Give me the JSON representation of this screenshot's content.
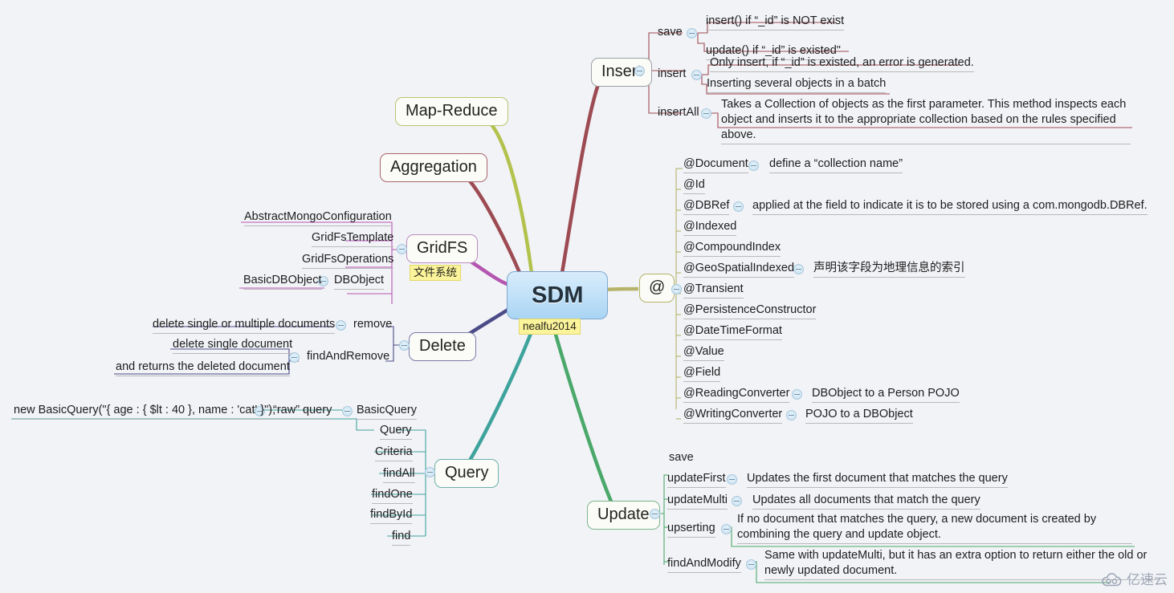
{
  "central": {
    "title": "SDM",
    "tag": "nealfu2014"
  },
  "watermark": {
    "text": "亿速云",
    "icon": "cloud-icon"
  },
  "branches": {
    "insert": {
      "label": "Insert",
      "color": "#9d4b52",
      "items": [
        {
          "label": "save",
          "notes": [
            "insert() if “_id” is NOT exist",
            "update() if “_id” is existed\""
          ]
        },
        {
          "label": "insert",
          "notes": [
            "Only insert, if “_id” is existed, an error is generated.",
            "Inserting several objects in a batch"
          ]
        },
        {
          "label": "insertAll",
          "notes": [
            "Takes a Collection of objects as the first parameter. This method inspects each object and inserts it to the appropriate collection based on the rules specified above."
          ]
        }
      ]
    },
    "mapreduce": {
      "label": "Map-Reduce",
      "color": "#b3c24d"
    },
    "aggregation": {
      "label": "Aggregation",
      "color": "#9d4b52"
    },
    "gridfs": {
      "label": "GridFS",
      "tag": "文件系统",
      "color": "#b455b0",
      "items": [
        {
          "label": "AbstractMongoConfiguration"
        },
        {
          "label": "GridFsTemplate"
        },
        {
          "label": "GridFsOperations"
        },
        {
          "label": "DBObject",
          "note": "BasicDBObject"
        }
      ]
    },
    "annotations": {
      "label": "@",
      "color": "#b5b46a",
      "items": [
        {
          "label": "@Document",
          "note": "define a “collection name”"
        },
        {
          "label": "@Id",
          "note": ""
        },
        {
          "label": "@DBRef",
          "note": "applied at the field to indicate it is to be stored using a com.mongodb.DBRef."
        },
        {
          "label": "@Indexed",
          "note": ""
        },
        {
          "label": "@CompoundIndex",
          "note": ""
        },
        {
          "label": "@GeoSpatialIndexed",
          "note": "声明该字段为地理信息的索引"
        },
        {
          "label": "@Transient",
          "note": ""
        },
        {
          "label": "@PersistenceConstructor",
          "note": ""
        },
        {
          "label": "@DateTimeFormat",
          "note": ""
        },
        {
          "label": "@Value",
          "note": ""
        },
        {
          "label": "@Field",
          "note": ""
        },
        {
          "label": "@ReadingConverter",
          "note": "DBObject to a Person POJO"
        },
        {
          "label": "@WritingConverter",
          "note": "POJO to a DBObject"
        }
      ]
    },
    "delete": {
      "label": "Delete",
      "color": "#4b4b88",
      "items": [
        {
          "label": "remove",
          "notes": [
            "delete single or multiple documents"
          ]
        },
        {
          "label": "findAndRemove",
          "notes": [
            "delete single document",
            "and returns the deleted document"
          ]
        }
      ]
    },
    "query": {
      "label": "Query",
      "color": "#3ea39c",
      "items": [
        {
          "label": "Query"
        },
        {
          "label": "Criteria"
        },
        {
          "label": "findAll"
        },
        {
          "label": "findOne"
        },
        {
          "label": "findById"
        },
        {
          "label": "find"
        }
      ],
      "basicquery": {
        "label": "BasicQuery",
        "note": "“raw” query",
        "code": "new BasicQuery(\"{ age : { $lt : 40 }, name : 'cat' }\");"
      }
    },
    "update": {
      "label": "Update",
      "color": "#4aa86a",
      "items": [
        {
          "label": "save",
          "notes": []
        },
        {
          "label": "updateFirst",
          "notes": [
            "Updates the first document that matches the query"
          ]
        },
        {
          "label": "updateMulti",
          "notes": [
            "Updates all documents that match the query"
          ]
        },
        {
          "label": "upserting",
          "notes": [
            "If no document that matches the query, a new document is created by combining the query and update object."
          ]
        },
        {
          "label": "findAndModify",
          "notes": [
            "Same with updateMulti, but it has an extra option to return either the old or newly updated document."
          ]
        }
      ]
    }
  }
}
